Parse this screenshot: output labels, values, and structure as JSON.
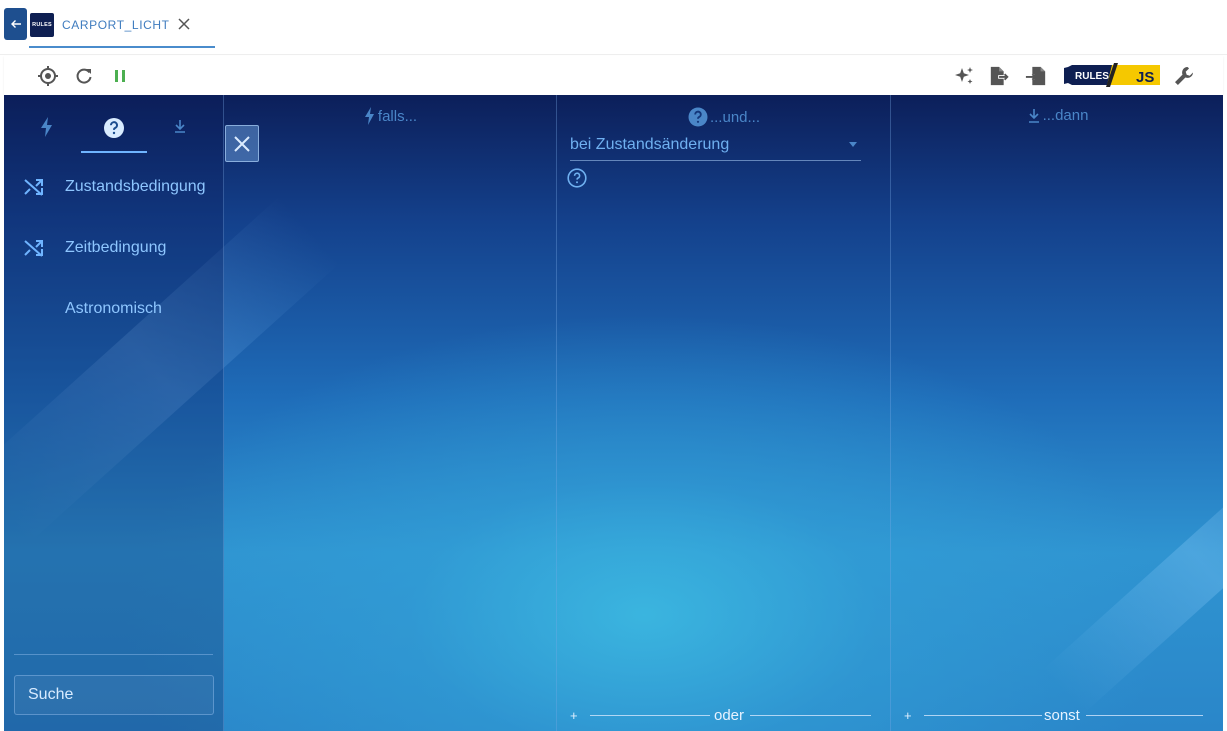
{
  "tab": {
    "label": "CARPORT_LICHT",
    "logo_text": "RULES"
  },
  "toolbar": {
    "logo_rules": "RULES",
    "logo_js": "JS"
  },
  "colors": {
    "accent": "#4a8ccc",
    "pause_green": "#4caf50",
    "logo_yellow": "#f5c800",
    "logo_navy": "#0e1f52"
  },
  "sidebar": {
    "tabs": [
      {
        "icon": "bolt-icon"
      },
      {
        "icon": "question-icon",
        "active": true
      },
      {
        "icon": "arrow-down-icon"
      }
    ],
    "items": [
      {
        "label": "Zustandsbedingung",
        "icon": "shuffle-icon"
      },
      {
        "label": "Zeitbedingung",
        "icon": "shuffle-icon"
      },
      {
        "label": "Astronomisch",
        "icon": "moon-icon"
      }
    ],
    "search": {
      "placeholder": "Suche"
    }
  },
  "columns": {
    "triggers": {
      "title": "falls..."
    },
    "conditions": {
      "title": "...und...",
      "select_value": "bei Zustandsänderung",
      "bottom_label": "oder",
      "bottom_plus": "+"
    },
    "actions": {
      "title": "...dann",
      "bottom_label": "sonst",
      "bottom_plus": "+"
    }
  }
}
